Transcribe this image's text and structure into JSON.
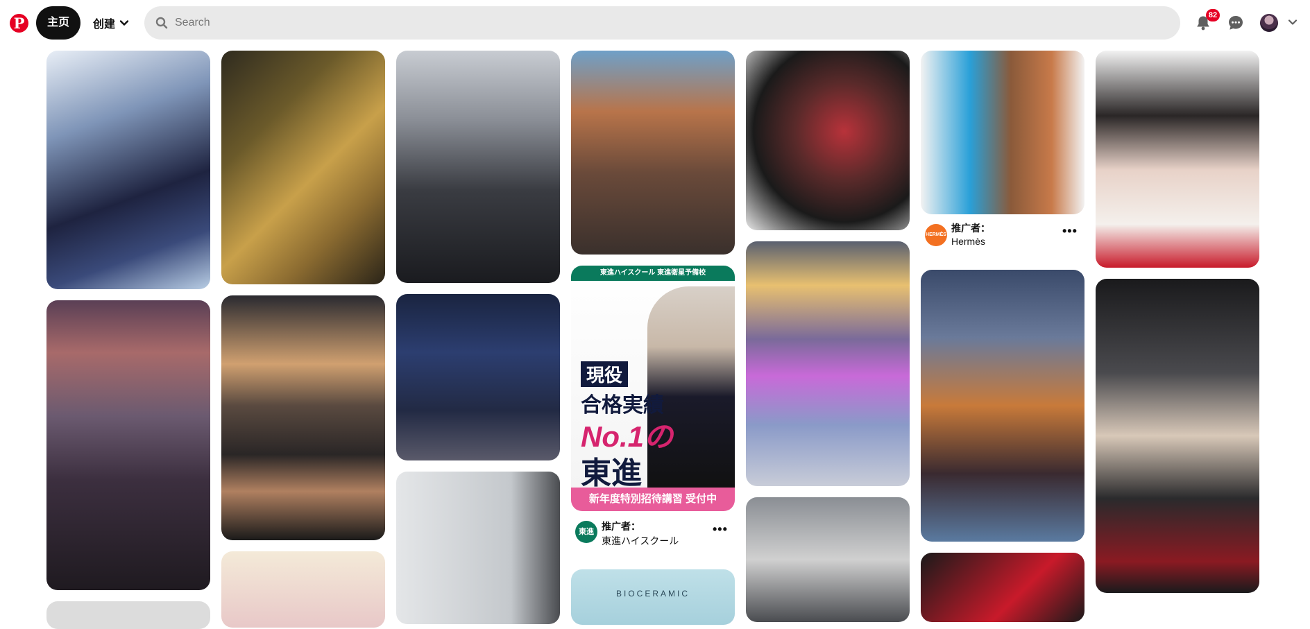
{
  "header": {
    "logo": "P",
    "home_label": "主页",
    "create_label": "创建",
    "search_placeholder": "Search",
    "notifications_count": "82"
  },
  "colors": {
    "brand": "#e60023",
    "active_nav": "#111111",
    "search_bg": "#e9e9e9"
  },
  "icons": {
    "logo": "pinterest-icon",
    "create_menu": "chevron-down-icon",
    "search": "search-icon",
    "notifications": "bell-icon",
    "messages": "chat-icon",
    "account_menu": "chevron-down-icon"
  },
  "pins": [
    {
      "id": "p1",
      "promoted": false
    },
    {
      "id": "p2",
      "promoted": false
    },
    {
      "id": "p3",
      "promoted": false
    },
    {
      "id": "p4",
      "promoted": false
    },
    {
      "id": "p5",
      "promoted": false
    },
    {
      "id": "p6",
      "promoted": true,
      "promo_label": "推广者：",
      "promo_name": "Hermès",
      "logo_text": "HERMÈS"
    },
    {
      "id": "p7",
      "promoted": false
    },
    {
      "id": "p8",
      "promoted": false
    },
    {
      "id": "p9",
      "promoted": false
    },
    {
      "id": "p10",
      "promoted": false
    },
    {
      "id": "p11",
      "promoted": true,
      "promo_label": "推广者：",
      "promo_name": "東進ハイスクール",
      "logo_text": "東進",
      "ad": {
        "header": "東進ハイスクール 東進衛星予備校",
        "line1": "現役",
        "line2": "合格実績",
        "line3": "No.1の",
        "line4": "東進",
        "bottom": "新年度特別招待講習 受付中"
      }
    },
    {
      "id": "p12",
      "promoted": false
    },
    {
      "id": "p13",
      "promoted": false
    },
    {
      "id": "p14",
      "promoted": false
    },
    {
      "id": "p15",
      "promoted": false
    },
    {
      "id": "p16",
      "promoted": false
    },
    {
      "id": "p17",
      "promoted": false
    },
    {
      "id": "p18",
      "promoted": false,
      "caption": "BIOCERAMIC"
    },
    {
      "id": "p19",
      "promoted": false
    },
    {
      "id": "p20",
      "promoted": false
    },
    {
      "id": "p21",
      "promoted": false
    }
  ]
}
